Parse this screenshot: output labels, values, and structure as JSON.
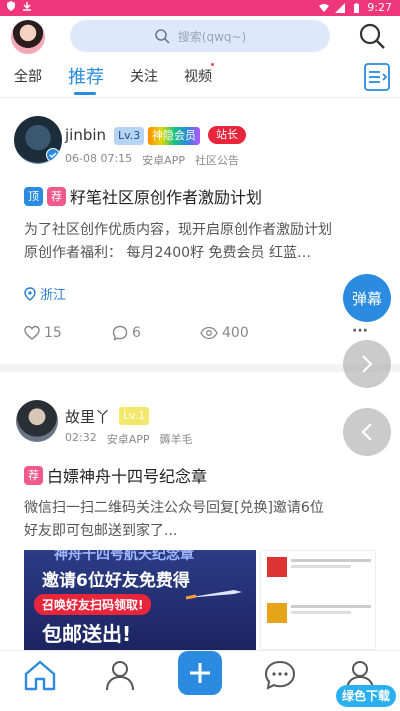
{
  "status_bar": {
    "time": "9:27",
    "icons": [
      "shield-icon",
      "download-icon",
      "wifi-icon",
      "signal-icon",
      "battery-icon"
    ]
  },
  "header": {
    "search_placeholder": "搜索(qwq~)",
    "avatar_icon": "avatar"
  },
  "tabs": [
    {
      "label": "全部",
      "active": false
    },
    {
      "label": "推荐",
      "active": true
    },
    {
      "label": "关注",
      "active": false
    },
    {
      "label": "视频",
      "active": false,
      "has_dot": true
    }
  ],
  "posts": [
    {
      "author": "jinbin",
      "level": "Lv.3",
      "badges": [
        "神隐会员",
        "站长"
      ],
      "verified": true,
      "time": "06-08 07:15",
      "source": "安卓APP",
      "category": "社区公告",
      "tags": [
        "顶",
        "荐"
      ],
      "title": "籽笔社区原创作者激励计划",
      "body_lines": [
        "为了社区创作优质内容，现开启原创作者激励计划",
        "原创作者福利：    每月2400籽 免费会员   红蓝…"
      ],
      "location": "浙江",
      "likes": "15",
      "comments": "6",
      "views": "400"
    },
    {
      "author": "故里丫",
      "level": "Lv.1",
      "time": "02:32",
      "source": "安卓APP",
      "category": "薅羊毛",
      "tags": [
        "荐"
      ],
      "title": "白嫖神舟十四号纪念章",
      "body_lines": [
        "微信扫一扫二维码关注公众号回复[兑换]邀请6位",
        "好友即可包邮送到家了..."
      ],
      "image_texts": [
        "神舟十四号航天纪念章",
        "邀请6位好友免费得",
        "召唤好友扫码领取!",
        "包邮送出!"
      ]
    }
  ],
  "floating": {
    "danmu_label": "弹幕"
  },
  "bottom_nav": [
    "home-icon",
    "user-icon",
    "add-icon",
    "message-icon",
    "profile-icon"
  ],
  "watermark": "绿色下载",
  "colors": {
    "accent": "#2a8be0",
    "statusbar": "#f0367a",
    "tag_top": "#2a8be0",
    "tag_rec": "#f05a8a"
  }
}
